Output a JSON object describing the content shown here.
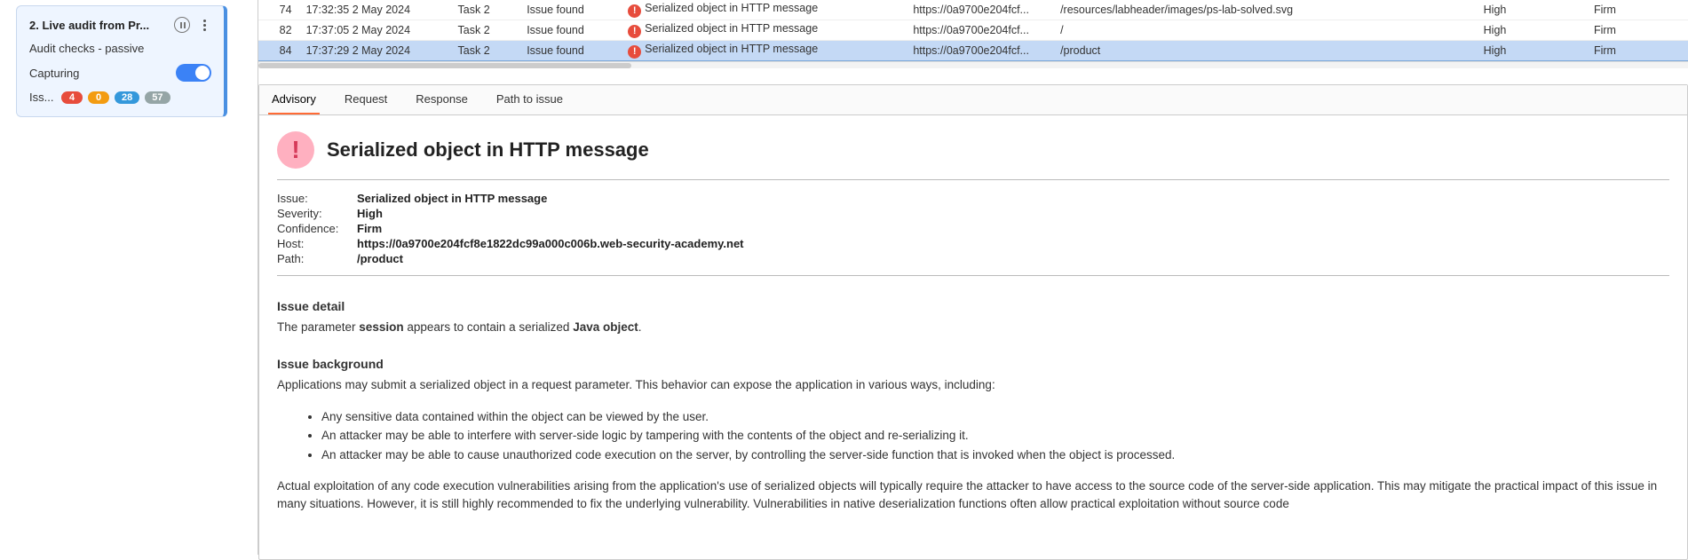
{
  "sidebar": {
    "title": "2. Live audit from Pr...",
    "audit_checks": "Audit checks - passive",
    "capturing_label": "Capturing",
    "iss_label": "Iss...",
    "badges": {
      "red": "4",
      "orange": "0",
      "blue": "28",
      "gray": "57"
    }
  },
  "table": {
    "rows": [
      {
        "id": "74",
        "time": "17:32:35 2 May 2024",
        "task": "Task 2",
        "status": "Issue found",
        "issue": "Serialized object in HTTP message",
        "host": "https://0a9700e204fcf...",
        "path": "/resources/labheader/images/ps-lab-solved.svg",
        "sev": "High",
        "conf": "Firm",
        "sel": false
      },
      {
        "id": "82",
        "time": "17:37:05 2 May 2024",
        "task": "Task 2",
        "status": "Issue found",
        "issue": "Serialized object in HTTP message",
        "host": "https://0a9700e204fcf...",
        "path": "/",
        "sev": "High",
        "conf": "Firm",
        "sel": false
      },
      {
        "id": "84",
        "time": "17:37:29 2 May 2024",
        "task": "Task 2",
        "status": "Issue found",
        "issue": "Serialized object in HTTP message",
        "host": "https://0a9700e204fcf...",
        "path": "/product",
        "sev": "High",
        "conf": "Firm",
        "sel": true
      }
    ]
  },
  "tabs": {
    "advisory": "Advisory",
    "request": "Request",
    "response": "Response",
    "path": "Path to issue"
  },
  "advisory": {
    "title": "Serialized object in HTTP message",
    "meta": {
      "issue_label": "Issue:",
      "issue_val": "Serialized object in HTTP message",
      "severity_label": "Severity:",
      "severity_val": "High",
      "confidence_label": "Confidence:",
      "confidence_val": "Firm",
      "host_label": "Host:",
      "host_val": "https://0a9700e204fcf8e1822dc99a000c006b.web-security-academy.net",
      "path_label": "Path:",
      "path_val": "/product"
    },
    "detail_title": "Issue detail",
    "detail_pre": "The parameter ",
    "detail_param": "session",
    "detail_mid": " appears to contain a serialized ",
    "detail_obj": "Java object",
    "detail_post": ".",
    "bg_title": "Issue background",
    "bg_intro": "Applications may submit a serialized object in a request parameter. This behavior can expose the application in various ways, including:",
    "bg_bullets": [
      "Any sensitive data contained within the object can be viewed by the user.",
      "An attacker may be able to interfere with server-side logic by tampering with the contents of the object and re-serializing it.",
      "An attacker may be able to cause unauthorized code execution on the server, by controlling the server-side function that is invoked when the object is processed."
    ],
    "bg_outro": "Actual exploitation of any code execution vulnerabilities arising from the application's use of serialized objects will typically require the attacker to have access to the source code of the server-side application. This may mitigate the practical impact of this issue in many situations. However, it is still highly recommended to fix the underlying vulnerability. Vulnerabilities in native deserialization functions often allow practical exploitation without source code"
  }
}
